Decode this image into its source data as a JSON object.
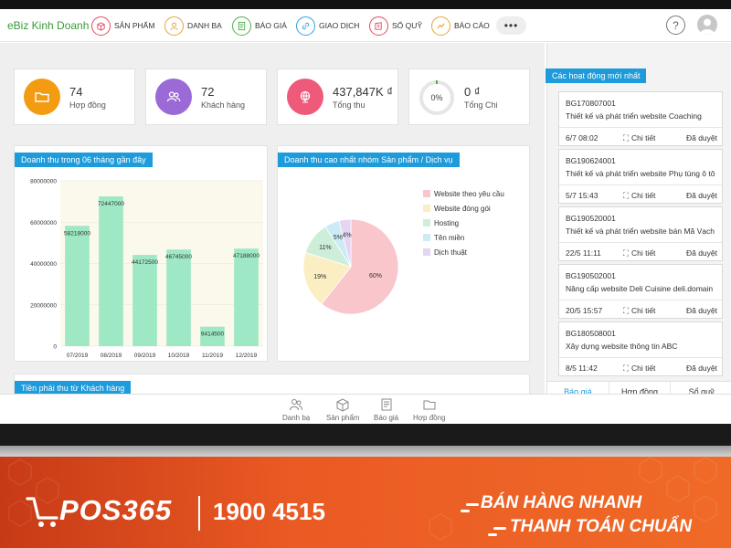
{
  "app": {
    "brand": "eBiz Kinh Doanh"
  },
  "nav": {
    "items": [
      {
        "label": "SẢN PHẨM",
        "icon": "box-icon",
        "color": "#e24b5e"
      },
      {
        "label": "DANH BẠ",
        "icon": "contacts-icon",
        "color": "#e8a33a"
      },
      {
        "label": "BÁO GIÁ",
        "icon": "quote-icon",
        "color": "#4fae47"
      },
      {
        "label": "GIAO DỊCH",
        "icon": "link-icon",
        "color": "#2ea3d8"
      },
      {
        "label": "SỔ QUỸ",
        "icon": "cash-book-icon",
        "color": "#e24b5e"
      },
      {
        "label": "BÁO CÁO",
        "icon": "report-icon",
        "color": "#e8a33a"
      }
    ],
    "more": "•••",
    "help": "?"
  },
  "stats": [
    {
      "value": "74",
      "label": "Hợp đồng",
      "color": "#f39c12",
      "icon": "folder-icon"
    },
    {
      "value": "72",
      "label": "Khách hàng",
      "color": "#9b6ad6",
      "icon": "users-icon"
    },
    {
      "value": "437,847K ₫",
      "label": "Tổng thu",
      "color": "#ef5a7a",
      "icon": "globe-icon"
    },
    {
      "value": "0 ₫",
      "label": "Tổng Chi",
      "progress_text": "0%",
      "progress": 0
    }
  ],
  "revenue_panel": {
    "title": "Doanh thu trong 06 tháng gần đây"
  },
  "top_panel": {
    "title": "Doanh thu cao nhất nhóm Sản phẩm / Dịch vụ"
  },
  "receivable_panel": {
    "title": "Tiền phải thu từ Khách hàng"
  },
  "chart_data": [
    {
      "type": "bar",
      "categories": [
        "07/2019",
        "08/2019",
        "09/2019",
        "10/2019",
        "11/2019",
        "12/2019"
      ],
      "values": [
        58218000,
        72447000,
        44172500,
        46745000,
        9414500,
        47188000
      ],
      "value_labels": [
        "58218000",
        "72447000",
        "44172500",
        "46745000",
        "9414500",
        "47188000"
      ],
      "yticks": [
        "80000000",
        "60000000",
        "40000000",
        "20000000",
        "0"
      ],
      "ylim": [
        0,
        80000000
      ],
      "bar_color": "#9ee8c5"
    },
    {
      "type": "pie",
      "labels": [
        "Website theo yêu cầu",
        "Website đóng gói",
        "Hosting",
        "Tên miền",
        "Dịch thuật"
      ],
      "values": [
        60,
        19,
        11,
        5,
        4
      ],
      "slice_labels": [
        "60%",
        "19%",
        "11%",
        "5%",
        "4%"
      ],
      "colors": [
        "#f9c6cc",
        "#fbeec2",
        "#cdeed9",
        "#cdebf6",
        "#e6d4f3"
      ],
      "legend_position": "right"
    }
  ],
  "activity": {
    "title": "Các hoạt động mới nhất",
    "detail_label": "Chi tiết",
    "items": [
      {
        "code": "BG170807001",
        "title": "Thiết kế và phát triển website Coaching",
        "date": "6/7 08:02",
        "status": "Đã duyệt"
      },
      {
        "code": "BG190624001",
        "title": "Thiết kế và phát triển website Phụ tùng ô tô",
        "date": "5/7 15:43",
        "status": "Đã duyệt"
      },
      {
        "code": "BG190520001",
        "title": "Thiết kế và phát triển website bán Mã Vạch",
        "date": "22/5 11:11",
        "status": "Đã duyệt"
      },
      {
        "code": "BG190502001",
        "title": "Nâng cấp website Deli Cuisine deli.domain",
        "date": "20/5 15:57",
        "status": "Đã duyệt"
      },
      {
        "code": "BG180508001",
        "title": "Xây dựng website thông tin ABC",
        "date": "8/5 11:42",
        "status": "Đã duyệt"
      }
    ],
    "tabs": [
      "Báo giá",
      "Hợp đồng",
      "Sổ quỹ"
    ]
  },
  "bottom_nav": [
    "Danh bạ",
    "Sản phẩm",
    "Báo giá",
    "Hợp đồng"
  ],
  "banner": {
    "logo": "POS365",
    "hotline": "1900 4515",
    "slogan_line1": "BÁN HÀNG NHANH",
    "slogan_line2": "THANH TOÁN CHUẨN"
  }
}
